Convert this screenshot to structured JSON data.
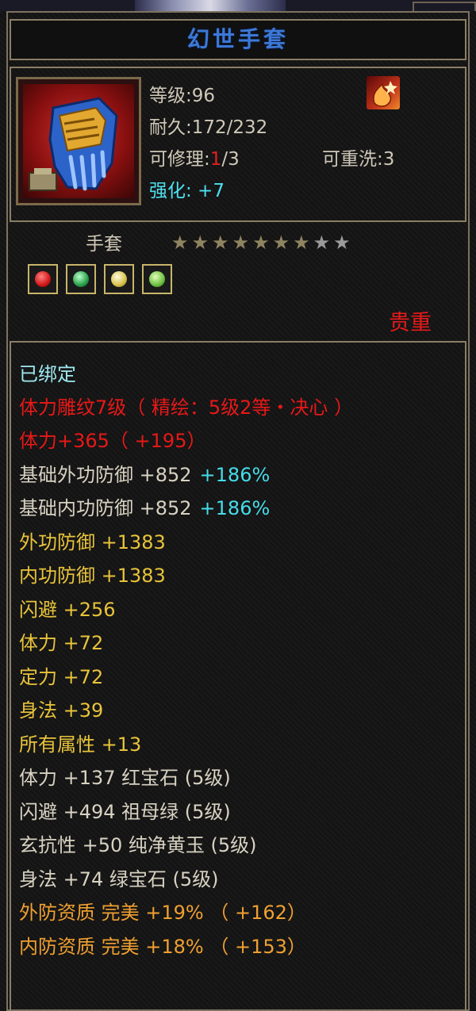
{
  "item": {
    "title": "幻世手套",
    "level": "等级:96",
    "durability": "耐久:172/232",
    "repair_prefix": "可修理:",
    "repair_current": "1",
    "repair_suffix": "/3",
    "rewash": "可重洗:3",
    "enhance": "强化: +7",
    "type": "手套",
    "rarity": "贵重",
    "stars_filled": 7,
    "stars_total": 9
  },
  "gems": [
    {
      "name": "red-gem-icon",
      "color": "#d01818"
    },
    {
      "name": "green-gem-icon",
      "color": "#2aa04a"
    },
    {
      "name": "yellow-gem-icon",
      "color": "#d6c24a"
    },
    {
      "name": "emerald-gem-icon",
      "color": "#6cc040"
    }
  ],
  "attributes": {
    "bound": "已绑定",
    "engrave": "体力雕纹7级（ 精绘：5级2等・决心 ）",
    "stamina_total": "体力+365（ +195）",
    "base_ext_def": "基础外功防御 +852",
    "base_ext_def_pct": "+186%",
    "base_int_def": "基础内功防御 +852",
    "base_int_def_pct": "+186%",
    "ext_def": "外功防御 +1383",
    "int_def": "内功防御 +1383",
    "dodge": "闪避 +256",
    "stamina": "体力 +72",
    "focus": "定力 +72",
    "agility": "身法 +39",
    "all_attr": "所有属性 +13",
    "gem1": "体力 +137 红宝石 (5级)",
    "gem2": "闪避 +494 祖母绿 (5级)",
    "gem3": "玄抗性 +50 纯净黄玉 (5级)",
    "gem4": "身法 +74 绿宝石 (5级)",
    "aptitude_ext": "外防资质  完美 +19% （ +162）",
    "aptitude_int": "内防资质  完美 +18% （ +153）"
  }
}
